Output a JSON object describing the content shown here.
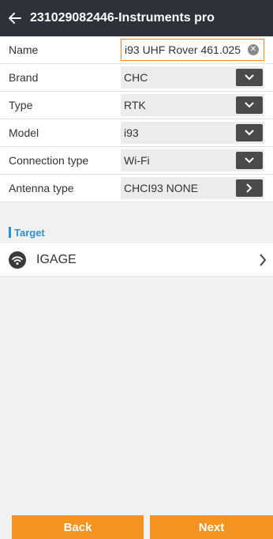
{
  "header": {
    "title": "231029082446-Instruments pro"
  },
  "form": {
    "name": {
      "label": "Name",
      "value": "i93 UHF Rover 461.025"
    },
    "brand": {
      "label": "Brand",
      "value": "CHC"
    },
    "type": {
      "label": "Type",
      "value": "RTK"
    },
    "model": {
      "label": "Model",
      "value": "i93"
    },
    "connection": {
      "label": "Connection type",
      "value": "Wi-Fi"
    },
    "antenna": {
      "label": "Antenna type",
      "value": "CHCI93 NONE"
    }
  },
  "target": {
    "section_label": "Target",
    "item_label": "IGAGE",
    "icon": "wifi-icon"
  },
  "footer": {
    "back_label": "Back",
    "next_label": "Next"
  },
  "colors": {
    "header_bg": "#2e3238",
    "accent": "#f39321",
    "section": "#2f8fd8"
  }
}
